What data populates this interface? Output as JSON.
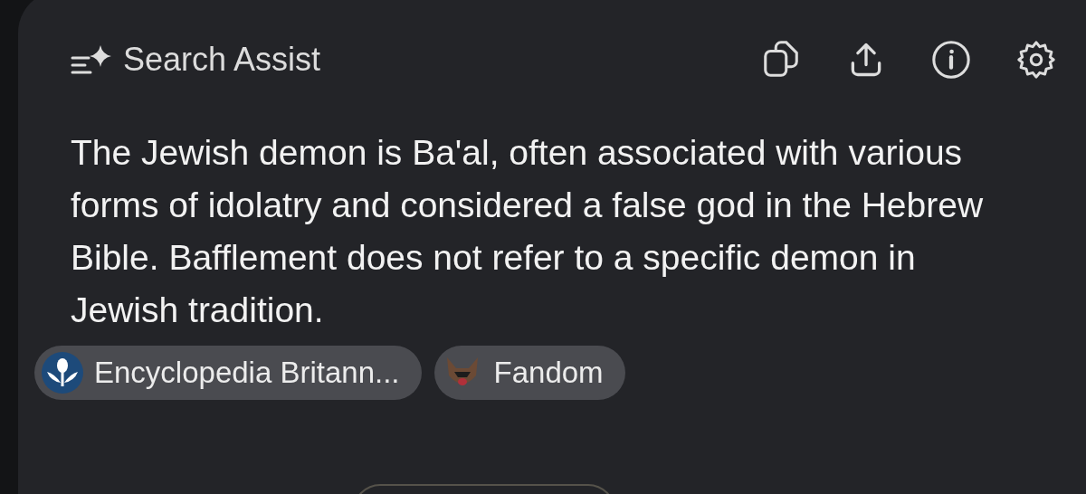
{
  "header": {
    "title": "Search Assist"
  },
  "answer": "The Jewish demon is Ba'al, often associated with various forms of idolatry and considered a false god in the Hebrew Bible. Bafflement does not refer to a specific demon in Jewish tradition.",
  "sources": [
    {
      "label": "Encyclopedia Britann...",
      "kind": "britannica"
    },
    {
      "label": "Fandom",
      "kind": "fandom"
    }
  ]
}
